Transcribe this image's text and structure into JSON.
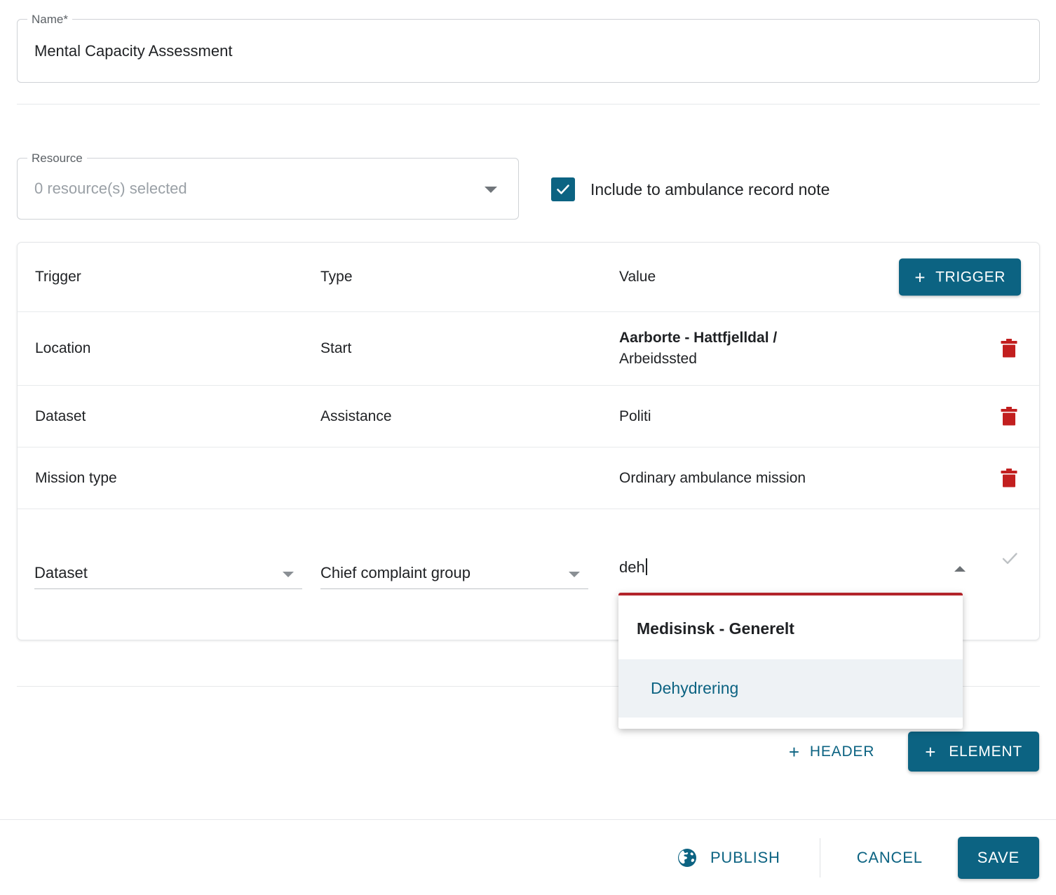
{
  "name_field": {
    "legend": "Name*",
    "value": "Mental Capacity Assessment"
  },
  "resource_field": {
    "legend": "Resource",
    "placeholder": "0 resource(s) selected",
    "caret_icon": "chevron-down-icon"
  },
  "include_note": {
    "label": "Include to ambulance record note",
    "checked": true,
    "check_icon": "check-icon",
    "accent_color": "#0c6382"
  },
  "trigger_table": {
    "columns": {
      "trigger": "Trigger",
      "type": "Type",
      "value": "Value"
    },
    "add_trigger_button": {
      "label": "TRIGGER",
      "plus": "+",
      "icon": "plus-icon"
    },
    "rows": [
      {
        "trigger": "Location",
        "type": "Start",
        "value_strong": "Aarborte - Hattfjelldal /",
        "value_second": "Arbeidssted",
        "delete_icon": "trash-icon"
      },
      {
        "trigger": "Dataset",
        "type": "Assistance",
        "value": "Politi",
        "delete_icon": "trash-icon"
      },
      {
        "trigger": "Mission type",
        "type": "",
        "value": "Ordinary ambulance mission",
        "delete_icon": "trash-icon"
      }
    ],
    "edit_row": {
      "dataset_select": "Dataset",
      "complaint_select": "Chief complaint group",
      "value_input": "deh",
      "confirm_icon": "check-icon",
      "collapse_icon": "chevron-up-icon"
    }
  },
  "autocomplete": {
    "accent_bar_color": "#b2232a",
    "group_header": "Medisinsk - Generelt",
    "options": [
      {
        "label": "Dehydrering",
        "active": true
      }
    ]
  },
  "element_actions": {
    "header_button": {
      "label": "HEADER",
      "plus": "+",
      "icon": "plus-icon"
    },
    "element_button": {
      "label": "ELEMENT",
      "plus": "+",
      "icon": "plus-icon"
    }
  },
  "footer": {
    "publish": {
      "label": "PUBLISH",
      "icon": "globe-icon"
    },
    "cancel": {
      "label": "CANCEL"
    },
    "save": {
      "label": "SAVE"
    }
  },
  "colors": {
    "accent": "#0c6382",
    "danger": "#b2232a",
    "trash": "#c21f1f"
  }
}
